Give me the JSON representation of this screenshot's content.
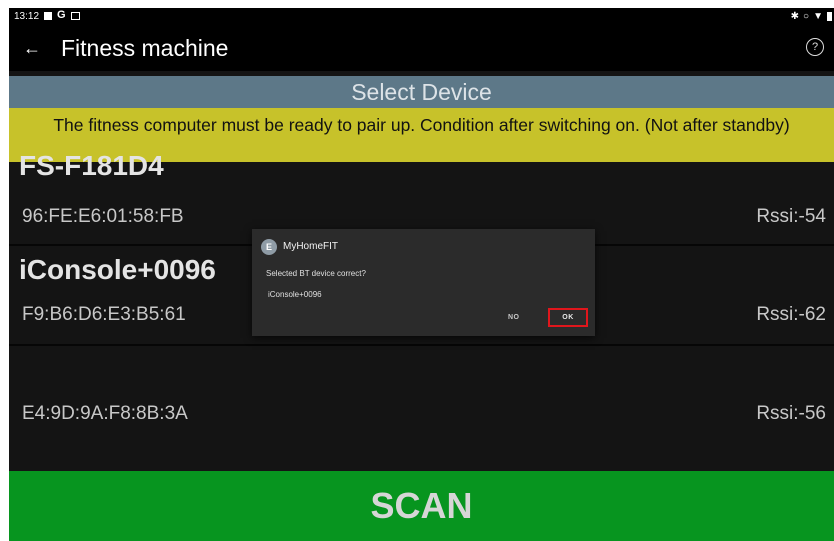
{
  "status_bar": {
    "time": "13:12",
    "left_icons": [
      "notification-square-icon",
      "google-g-icon",
      "screen-icon"
    ],
    "right_icons": [
      "bluetooth-icon",
      "sync-icon",
      "wifi-icon",
      "battery-icon"
    ]
  },
  "app_bar": {
    "title": "Fitness machine",
    "back_icon": "arrow-left-icon",
    "help_icon": "help-circle-icon"
  },
  "select_header": "Select Device",
  "banner": "The fitness computer must be ready to pair up. Condition after switching on. (Not after standby)",
  "devices": [
    {
      "name": "FS-F181D4",
      "mac": "96:FE:E6:01:58:FB",
      "rssi": "Rssi:-54"
    },
    {
      "name": "iConsole+0096",
      "mac": "F9:B6:D6:E3:B5:61",
      "rssi": "Rssi:-62"
    },
    {
      "name": "",
      "mac": "E4:9D:9A:F8:8B:3A",
      "rssi": "Rssi:-56"
    }
  ],
  "scan_label": "SCAN",
  "dialog": {
    "app_name": "MyHomeFIT",
    "message": "Selected BT device correct?",
    "device": "iConsole+0096",
    "no_label": "NO",
    "ok_label": "OK"
  },
  "colors": {
    "select_header": "#5d7888",
    "banner": "#c7c22a",
    "scan": "#07951f",
    "ok_highlight": "#e0161c"
  }
}
